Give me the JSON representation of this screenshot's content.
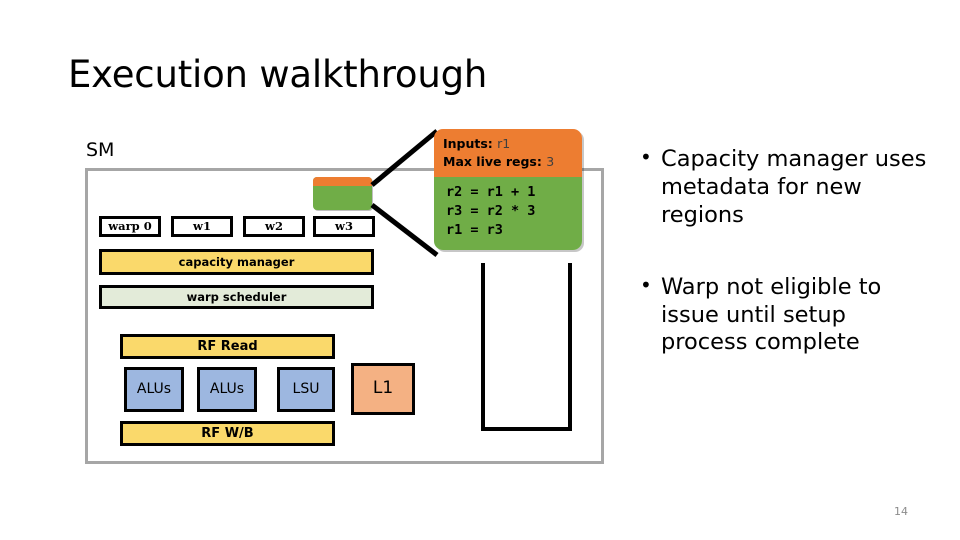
{
  "slide": {
    "title": "Execution walkthrough",
    "number": "14"
  },
  "sm": {
    "label": "SM",
    "warps": [
      {
        "label": "warp 0"
      },
      {
        "label": "w1"
      },
      {
        "label": "w2"
      },
      {
        "label": "w3"
      }
    ],
    "capacity_manager": "capacity manager",
    "warp_scheduler": "warp scheduler",
    "rf_read": "RF Read",
    "rf_writeback": "RF W/B",
    "units": [
      {
        "label": "ALUs"
      },
      {
        "label": "ALUs"
      },
      {
        "label": "LSU"
      }
    ],
    "cache": "L1"
  },
  "callout": {
    "inputs_label": "Inputs:",
    "inputs_value": "r1",
    "max_live_regs_label": "Max live regs:",
    "max_live_regs_value": "3",
    "code": "r2 = r1 + 1\nr3 = r2 * 3\nr1 = r3"
  },
  "bullets": [
    "Capacity manager uses metadata for new regions",
    "Warp not eligible to issue until setup process complete"
  ],
  "colors": {
    "orange": "#ED7D31",
    "green": "#70AD47",
    "gold": "#FAD96B",
    "pale_green": "#E3EBD9",
    "blue": "#9DB7E0",
    "salmon": "#F4B183",
    "sm_border": "#A6A6A6"
  }
}
